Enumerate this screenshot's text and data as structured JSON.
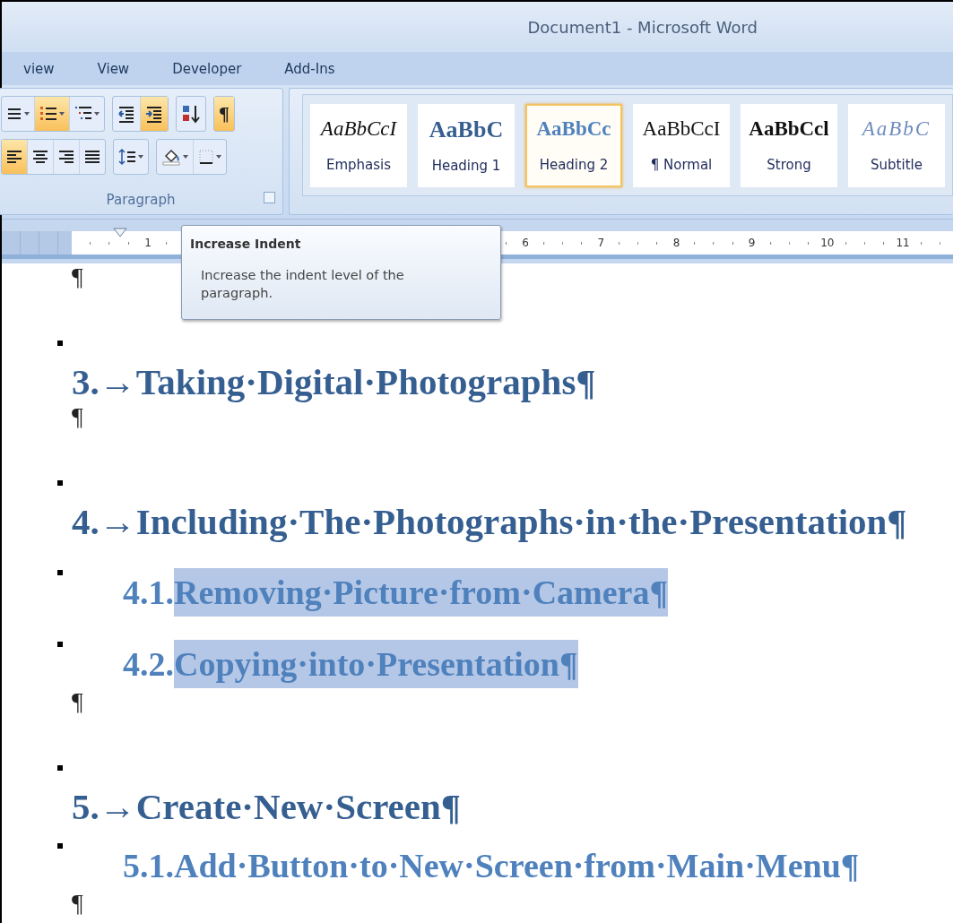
{
  "window": {
    "title": "Document1 - Microsoft Word"
  },
  "tabs": [
    {
      "label": "view",
      "selected": false
    },
    {
      "label": "View",
      "selected": false
    },
    {
      "label": "Developer",
      "selected": false
    },
    {
      "label": "Add-Ins",
      "selected": false
    }
  ],
  "paragraph_group": {
    "label": "Paragraph",
    "rows": [
      [
        [
          {
            "kind": "bullets",
            "on": false,
            "caret": true
          },
          {
            "kind": "numbering",
            "on": true,
            "caret": true
          },
          {
            "kind": "multilevel",
            "on": false,
            "caret": true
          }
        ],
        [
          {
            "kind": "decrease_indent",
            "on": false,
            "caret": false
          },
          {
            "kind": "increase_indent",
            "on": true,
            "caret": false
          }
        ],
        [
          {
            "kind": "sort",
            "on": false,
            "caret": false
          }
        ],
        [
          {
            "kind": "show_hide",
            "on": true,
            "caret": false,
            "label": "¶"
          }
        ]
      ],
      [
        [
          {
            "kind": "align_left",
            "on": true,
            "caret": false
          },
          {
            "kind": "align_center",
            "on": false,
            "caret": false
          },
          {
            "kind": "align_right",
            "on": false,
            "caret": false
          },
          {
            "kind": "justify",
            "on": false,
            "caret": false
          }
        ],
        [
          {
            "kind": "line_spacing",
            "on": false,
            "caret": true
          }
        ],
        [
          {
            "kind": "shading",
            "on": false,
            "caret": true
          },
          {
            "kind": "borders",
            "on": false,
            "caret": true
          }
        ]
      ]
    ]
  },
  "styles": [
    {
      "kind": "emphasis",
      "preview": "AaBbCcI",
      "name": "Emphasis",
      "selected": false
    },
    {
      "kind": "heading1",
      "preview": "AaBbC",
      "name": "Heading 1",
      "selected": false
    },
    {
      "kind": "heading2",
      "preview": "AaBbCc",
      "name": "Heading 2",
      "selected": true
    },
    {
      "kind": "normal",
      "preview": "AaBbCcI",
      "name": "¶ Normal",
      "selected": false
    },
    {
      "kind": "strong",
      "preview": "AaBbCcl",
      "name": "Strong",
      "selected": false
    },
    {
      "kind": "subtitle",
      "preview": "AaBbC",
      "name": "Subtitle",
      "selected": false
    }
  ],
  "ruler": {
    "left_numbers": [
      "1"
    ],
    "right_numbers": [
      "6",
      "7",
      "8",
      "9",
      "10",
      "11"
    ]
  },
  "tooltip": {
    "title": "Increase Indent",
    "text": "Increase the indent level of the paragraph."
  },
  "document": {
    "paragraphs": [
      {
        "kind": "empty",
        "text": "¶"
      },
      {
        "kind": "heading1",
        "keep_mark": true,
        "number": "3.→",
        "text": "Taking·Digital·Photographs¶",
        "selected": false
      },
      {
        "kind": "empty",
        "text": "¶"
      },
      {
        "kind": "heading1",
        "keep_mark": true,
        "number": "4.→",
        "text": "Including·The·Photographs·in·the·Presentation¶",
        "selected": false
      },
      {
        "kind": "heading2",
        "keep_mark": true,
        "number": "4.1.",
        "text": "Removing·Picture·from·Camera¶",
        "selected": true
      },
      {
        "kind": "heading2",
        "keep_mark": true,
        "number": "4.2.",
        "text": "Copying·into·Presentation¶",
        "selected": true
      },
      {
        "kind": "empty",
        "text": "¶"
      },
      {
        "kind": "heading1",
        "keep_mark": true,
        "number": "5.→",
        "text": "Create·New·Screen¶",
        "selected": false
      },
      {
        "kind": "heading2",
        "keep_mark": true,
        "number": "5.1.",
        "text": "Add·Button·to·New·Screen·from·Main·Menu¶",
        "selected": false
      },
      {
        "kind": "empty",
        "text": "¶"
      }
    ]
  }
}
